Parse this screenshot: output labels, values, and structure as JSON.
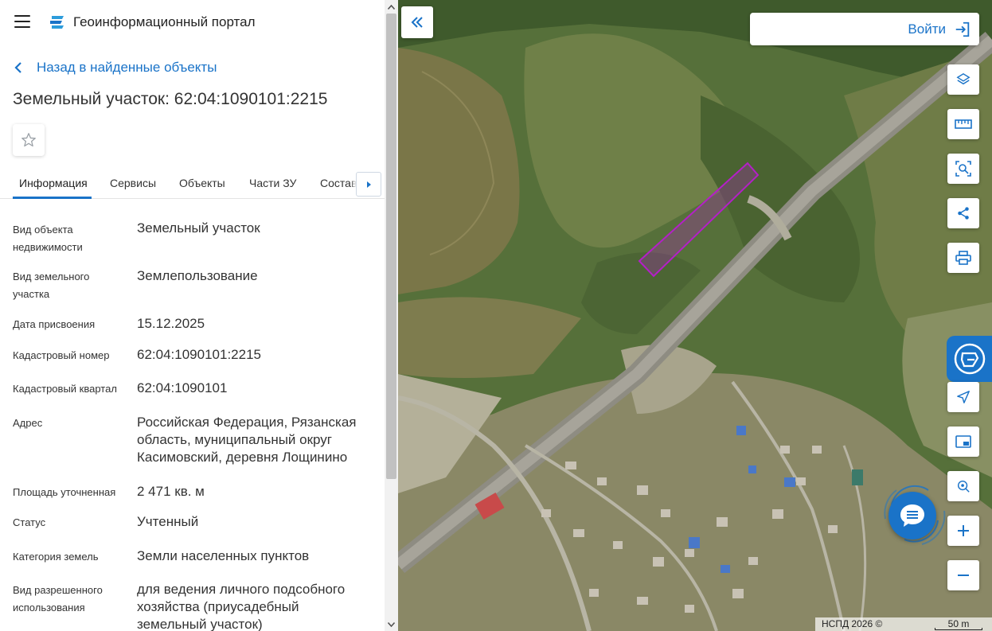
{
  "header": {
    "app_title": "Геоинформационный портал",
    "menu_icon": "hamburger-icon",
    "logo_icon": "portal-logo-icon"
  },
  "navigation": {
    "back_label": "Назад в найденные объекты"
  },
  "object": {
    "title": "Земельный участок: 62:04:1090101:2215"
  },
  "tabs": [
    {
      "label": "Информация",
      "active": true
    },
    {
      "label": "Сервисы",
      "active": false
    },
    {
      "label": "Объекты",
      "active": false
    },
    {
      "label": "Части ЗУ",
      "active": false
    },
    {
      "label": "Состав",
      "active": false
    }
  ],
  "properties": [
    {
      "label": "Вид объекта недвижимости",
      "value": "Земельный участок"
    },
    {
      "label": "Вид земельного участка",
      "value": "Землепользование"
    },
    {
      "label": "Дата присвоения",
      "value": "15.12.2025"
    },
    {
      "label": "Кадастровый номер",
      "value": "62:04:1090101:2215"
    },
    {
      "label": "Кадастровый квартал",
      "value": "62:04:1090101"
    },
    {
      "label": "Адрес",
      "value": "Российская Федерация, Рязанская область, муниципальный округ Касимовский, деревня Лощинино"
    },
    {
      "label": "Площадь уточненная",
      "value": "2 471 кв. м"
    },
    {
      "label": "Статус",
      "value": "Учтенный"
    },
    {
      "label": "Категория земель",
      "value": "Земли населенных пунктов"
    },
    {
      "label": "Вид разрешенного использования",
      "value": "для ведения личного подсобного хозяйства (приусадебный земельный участок)"
    }
  ],
  "map": {
    "login_label": "Войти",
    "attribution": "НСПД 2026 ©",
    "scale_label": "50 m",
    "tools": [
      "layers-icon",
      "ruler-icon",
      "area-select-icon",
      "share-icon",
      "print-icon",
      "navigate-icon",
      "minimap-icon",
      "search-location-icon",
      "zoom-in-icon",
      "zoom-out-icon"
    ],
    "accent_color": "#1a73c8",
    "parcel_color": "#b41fc8"
  }
}
